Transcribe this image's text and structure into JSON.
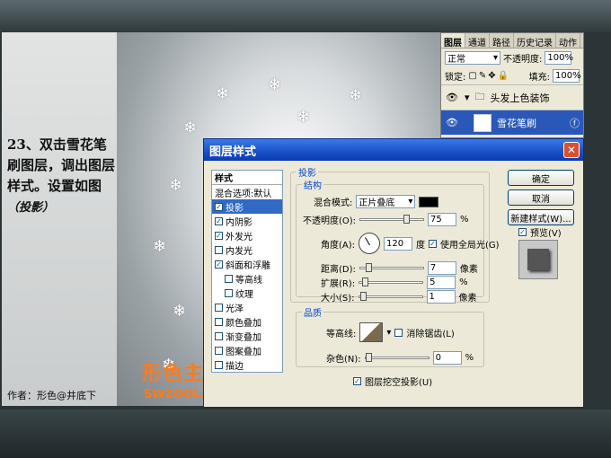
{
  "tutorial": {
    "step_text": "23、双击雪花笔刷图层，调出图层样式。设置如图",
    "step_sub": "（投影）",
    "author": "作者：形色@井底下"
  },
  "watermark": {
    "line1": "形色主义",
    "line2": "SWZOOL.COM"
  },
  "layers_panel": {
    "tabs": [
      "图层",
      "通道",
      "路径",
      "历史记录",
      "动作"
    ],
    "blend_mode": "正常",
    "opacity_label": "不透明度:",
    "opacity_value": "100%",
    "lock_label": "锁定:",
    "fill_label": "填充:",
    "fill_value": "100%",
    "layers": [
      {
        "name": "头发上色装饰",
        "type": "group"
      },
      {
        "name": "雪花笔刷",
        "type": "layer"
      }
    ]
  },
  "dialog": {
    "title": "图层样式",
    "styles_header": "样式",
    "style_items": [
      {
        "label": "混合选项:默认",
        "checkbox": false,
        "checked": false,
        "indent": false
      },
      {
        "label": "投影",
        "checkbox": true,
        "checked": true,
        "indent": false
      },
      {
        "label": "内阴影",
        "checkbox": true,
        "checked": true,
        "indent": false
      },
      {
        "label": "外发光",
        "checkbox": true,
        "checked": true,
        "indent": false
      },
      {
        "label": "内发光",
        "checkbox": true,
        "checked": false,
        "indent": false
      },
      {
        "label": "斜面和浮雕",
        "checkbox": true,
        "checked": true,
        "indent": false
      },
      {
        "label": "等高线",
        "checkbox": true,
        "checked": false,
        "indent": true
      },
      {
        "label": "纹理",
        "checkbox": true,
        "checked": false,
        "indent": true
      },
      {
        "label": "光泽",
        "checkbox": true,
        "checked": false,
        "indent": false
      },
      {
        "label": "颜色叠加",
        "checkbox": true,
        "checked": false,
        "indent": false
      },
      {
        "label": "渐变叠加",
        "checkbox": true,
        "checked": false,
        "indent": false
      },
      {
        "label": "图案叠加",
        "checkbox": true,
        "checked": false,
        "indent": false
      },
      {
        "label": "描边",
        "checkbox": true,
        "checked": false,
        "indent": false
      }
    ],
    "section_title": "投影",
    "structure_title": "结构",
    "blend_label": "混合模式:",
    "blend_value": "正片叠底",
    "opacity_label": "不透明度(O):",
    "opacity_value": "75",
    "angle_label": "角度(A):",
    "angle_value": "120",
    "angle_unit": "度",
    "global_light_label": "使用全局光(G)",
    "distance_label": "距离(D):",
    "distance_value": "7",
    "spread_label": "扩展(R):",
    "spread_value": "5",
    "size_label": "大小(S):",
    "size_value": "1",
    "px_unit": "像素",
    "percent_unit": "%",
    "quality_title": "品质",
    "contour_label": "等高线:",
    "antialias_label": "消除锯齿(L)",
    "noise_label": "杂色(N):",
    "noise_value": "0",
    "knockout_label": "图层挖空投影(U)",
    "ok_label": "确定",
    "cancel_label": "取消",
    "new_style_label": "新建样式(W)...",
    "preview_label": "预览(V)",
    "opacity_fraction": 0.75,
    "distance_fraction": 0.1,
    "spread_fraction": 0.05,
    "size_fraction": 0.02,
    "noise_fraction": 0.0
  }
}
